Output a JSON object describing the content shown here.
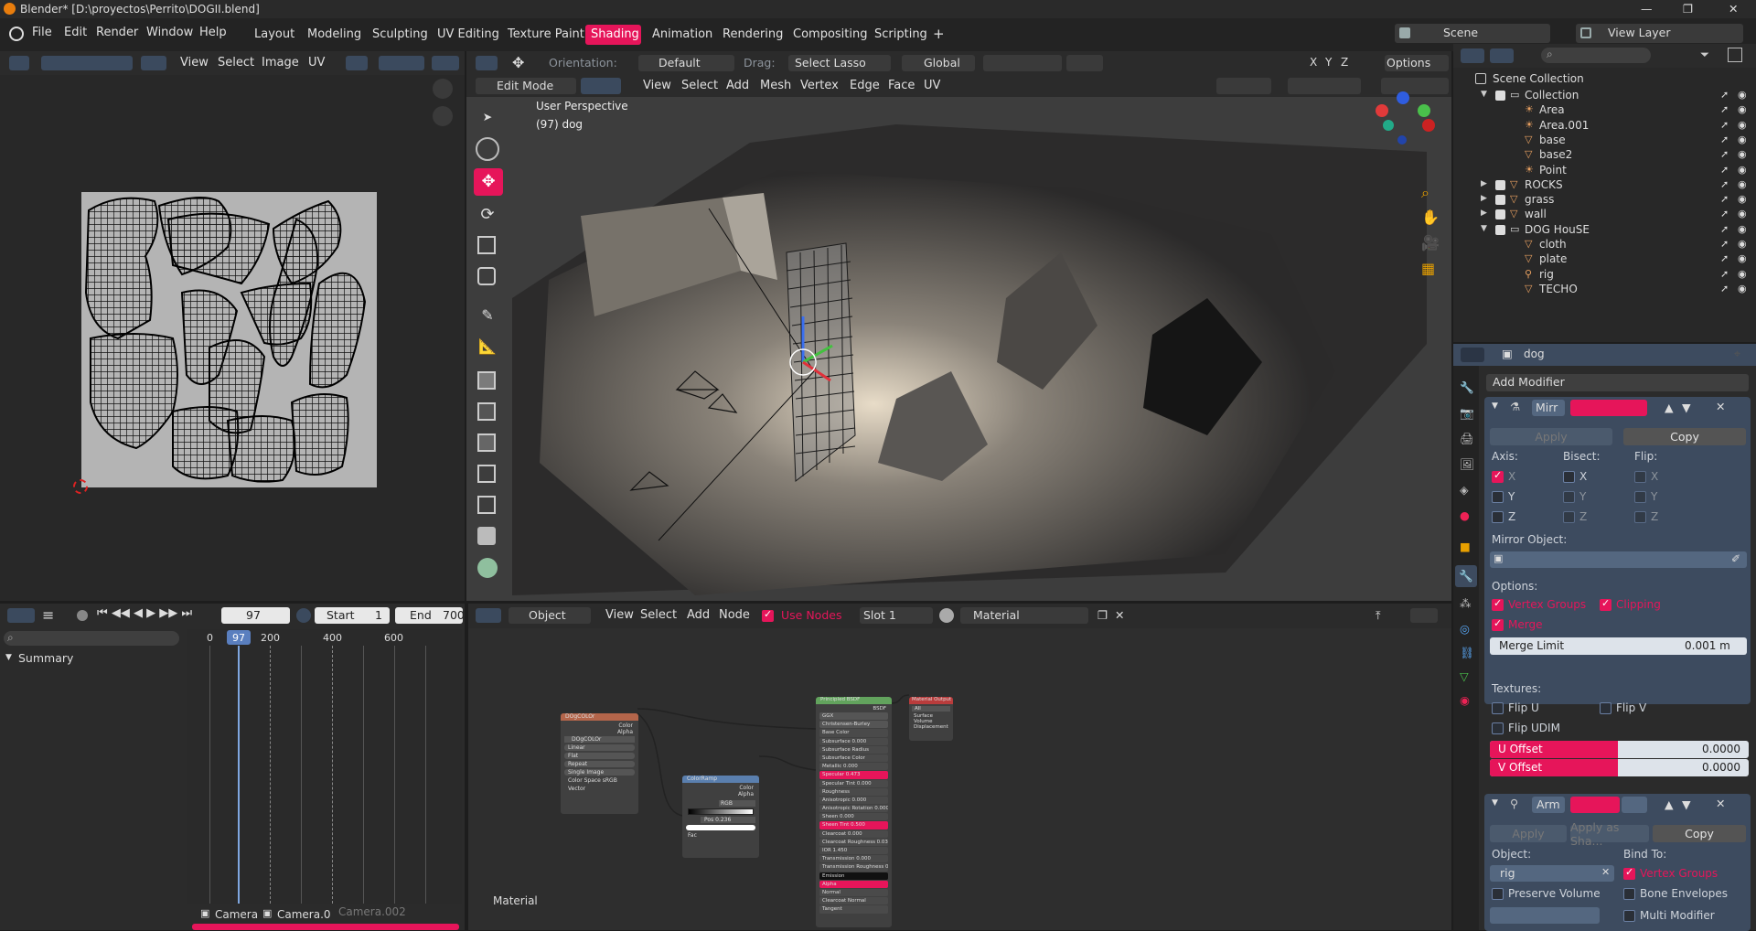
{
  "titlebar": {
    "title": "Blender* [D:\\proyectos\\Perrito\\DOGII.blend]",
    "min": "—",
    "max": "❐",
    "close": "✕"
  },
  "menu": [
    "File",
    "Edit",
    "Render",
    "Window",
    "Help"
  ],
  "workspaces": [
    "Layout",
    "Modeling",
    "Sculpting",
    "UV Editing",
    "Texture Paint",
    "Shading",
    "Animation",
    "Rendering",
    "Compositing",
    "Scripting"
  ],
  "active_workspace": "Shading",
  "add_workspace": "+",
  "scene": "Scene",
  "view_layer": "View Layer",
  "uv_header": {
    "menus": [
      "View",
      "Select",
      "Image",
      "UV"
    ]
  },
  "viewport_header": {
    "orientation_label": "Orientation:",
    "orientation_value": "Default",
    "drag_label": "Drag:",
    "drag_value": "Select Lasso",
    "transform": "Global",
    "xyz": [
      "X",
      "Y",
      "Z"
    ],
    "options": "Options",
    "mode": "Edit Mode",
    "menus": [
      "View",
      "Select",
      "Add",
      "Mesh",
      "Vertex",
      "Edge",
      "Face",
      "UV"
    ]
  },
  "viewport": {
    "view_name": "User Perspective",
    "object_info": "(97) dog"
  },
  "timeline": {
    "frame": "97",
    "start_label": "Start",
    "start": "1",
    "end_label": "End",
    "end": "700",
    "ruler": [
      "0",
      "200",
      "400",
      "600"
    ],
    "current_marker": "97",
    "summary": "Summary",
    "markers": [
      "Camera",
      "Camera.0",
      "Camera.002"
    ]
  },
  "node_editor": {
    "object_type": "Object",
    "menus": [
      "View",
      "Select",
      "Add",
      "Node"
    ],
    "use_nodes": "Use Nodes",
    "slot": "Slot 1",
    "material": "Material",
    "footer": "Material",
    "nodes": {
      "image": {
        "title": "DOgCOLOr",
        "outputs": [
          "Color",
          "Alpha"
        ],
        "fields": [
          "DOgCOLOr",
          "Linear",
          "Flat",
          "Repeat",
          "Single Image",
          "Color Space  sRGB",
          "Vector"
        ]
      },
      "ramp": {
        "title": "ColorRamp",
        "outputs": [
          "Color",
          "Alpha"
        ],
        "fields": [
          "RGB",
          "Linear",
          "Pos  0.236",
          "Fac"
        ]
      },
      "bsdf": {
        "title": "Principled BSDF",
        "output": "BSDF",
        "fields": [
          "GGX",
          "Christensen-Burley",
          "Base Color",
          "Subsurface  0.000",
          "Subsurface Radius",
          "Subsurface Color",
          "Metallic  0.000",
          "Specular  0.473",
          "Specular Tint  0.000",
          "Roughness",
          "Anisotropic  0.000",
          "Anisotropic Rotation  0.000",
          "Sheen  0.000",
          "Sheen Tint  0.500",
          "Clearcoat  0.000",
          "Clearcoat Roughness  0.030",
          "IOR  1.450",
          "Transmission  0.000",
          "Transmission Roughness  0.000",
          "Emission",
          "Alpha",
          "Normal",
          "Clearcoat Normal",
          "Tangent"
        ]
      },
      "output": {
        "title": "Material Output",
        "fields": [
          "All",
          "Surface",
          "Volume",
          "Displacement"
        ]
      }
    }
  },
  "outliner": {
    "root": "Scene Collection",
    "items": [
      {
        "name": "Collection",
        "level": 0,
        "type": "collection",
        "expanded": true
      },
      {
        "name": "Area",
        "level": 1,
        "type": "light"
      },
      {
        "name": "Area.001",
        "level": 1,
        "type": "light"
      },
      {
        "name": "base",
        "level": 1,
        "type": "mesh"
      },
      {
        "name": "base2",
        "level": 1,
        "type": "mesh"
      },
      {
        "name": "Point",
        "level": 1,
        "type": "light"
      },
      {
        "name": "ROCKS",
        "level": 0,
        "type": "mesh-top"
      },
      {
        "name": "grass",
        "level": 0,
        "type": "mesh-top"
      },
      {
        "name": "wall",
        "level": 0,
        "type": "mesh-top"
      },
      {
        "name": "DOG HouSE",
        "level": 0,
        "type": "collection",
        "expanded": true
      },
      {
        "name": "cloth",
        "level": 1,
        "type": "mesh"
      },
      {
        "name": "plate",
        "level": 1,
        "type": "mesh"
      },
      {
        "name": "rig",
        "level": 1,
        "type": "armature"
      },
      {
        "name": "TECHO",
        "level": 1,
        "type": "mesh"
      }
    ]
  },
  "properties": {
    "object": "dog",
    "add_modifier": "Add Modifier",
    "mirror": {
      "name": "Mirr",
      "apply": "Apply",
      "copy": "Copy",
      "axis_label": "Axis:",
      "bisect_label": "Bisect:",
      "flip_label": "Flip:",
      "axis": [
        "X",
        "Y",
        "Z"
      ],
      "mirror_object_label": "Mirror Object:",
      "options_label": "Options:",
      "vertex_groups": "Vertex Groups",
      "clipping": "Clipping",
      "merge": "Merge",
      "merge_limit_label": "Merge Limit",
      "merge_limit": "0.001 m",
      "textures_label": "Textures:",
      "flip_u": "Flip U",
      "flip_v": "Flip V",
      "flip_udim": "Flip UDIM",
      "u_offset_label": "U Offset",
      "u_offset": "0.0000",
      "v_offset_label": "V Offset",
      "v_offset": "0.0000"
    },
    "armature": {
      "name": "Arm",
      "apply": "Apply",
      "apply_shape": "Apply as Sha...",
      "copy": "Copy",
      "object_label": "Object:",
      "object": "rig",
      "bind_label": "Bind To:",
      "vertex_groups": "Vertex Groups",
      "preserve_volume": "Preserve Volume",
      "bone_envelopes": "Bone Envelopes",
      "multi_modifier": "Multi Modifier"
    }
  },
  "colors": {
    "accent": "#e6155a",
    "panel": "#303030",
    "header": "#2b2b2b",
    "blue_header": "#3d4b5f"
  }
}
